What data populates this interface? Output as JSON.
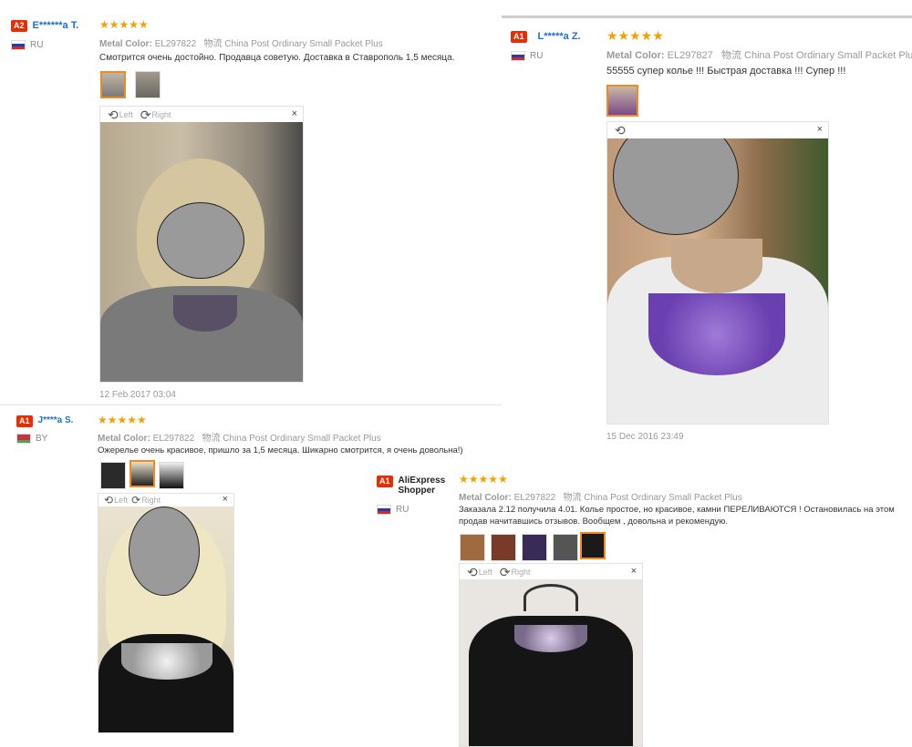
{
  "reviews": [
    {
      "badge": "A2",
      "name": "E******a T.",
      "country": "RU",
      "stars": "★★★★★",
      "meta_label": "Metal Color:",
      "meta_value": "EL297822",
      "shipping": "物流 China Post Ordinary Small Packet Plus",
      "text": "Смотрится очень достойно. Продавца советую. Доставка в Ставрополь 1,5 месяца.",
      "rotate_left": "Left",
      "rotate_right": "Right",
      "close": "×",
      "date": "12 Feb 2017 03:04"
    },
    {
      "badge": "A1",
      "name": "L*****a Z.",
      "country": "RU",
      "stars": "★★★★★",
      "meta_label": "Metal Color:",
      "meta_value": "EL297827",
      "shipping": "物流 China Post Ordinary Small Packet Plus",
      "text": "55555 супер колье !!! Быстрая доставка !!! Супер !!!",
      "close": "×",
      "date": "15 Dec 2016 23:49"
    },
    {
      "badge": "A1",
      "name": "J****a S.",
      "country": "BY",
      "stars": "★★★★★",
      "meta_label": "Metal Color:",
      "meta_value": "EL297822",
      "shipping": "物流 China Post Ordinary Small Packet Plus",
      "text": "Ожерелье очень красивое, пришло за 1,5 месяца. Шикарно смотрится, я очень довольна!)",
      "rotate_left": "Left",
      "rotate_right": "Right",
      "close": "×"
    },
    {
      "badge": "A1",
      "name": "AliExpress Shopper",
      "country": "RU",
      "stars": "★★★★★",
      "meta_label": "Metal Color:",
      "meta_value": "EL297822",
      "shipping": "物流 China Post Ordinary Small Packet Plus",
      "text": "Заказала 2.12 получила 4.01. Колье простое, но красивое, камни ПЕРЕЛИВАЮТСЯ ! Остановилась на этом продав начитавшись отзывов. Вообщем , довольна и рекомендую.",
      "rotate_left": "Left",
      "rotate_right": "Right",
      "close": "×"
    }
  ],
  "colors": {
    "accent": "#f08a24",
    "star": "#f4a100",
    "badge": "#e62e04",
    "name": "#1a6fd1"
  }
}
